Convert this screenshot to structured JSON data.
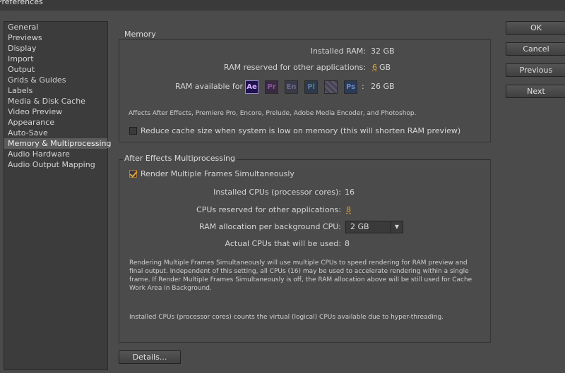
{
  "window": {
    "title": "Preferences"
  },
  "sidebar": {
    "items": [
      {
        "label": "General"
      },
      {
        "label": "Previews"
      },
      {
        "label": "Display"
      },
      {
        "label": "Import"
      },
      {
        "label": "Output"
      },
      {
        "label": "Grids & Guides"
      },
      {
        "label": "Labels"
      },
      {
        "label": "Media & Disk Cache"
      },
      {
        "label": "Video Preview"
      },
      {
        "label": "Appearance"
      },
      {
        "label": "Auto-Save"
      },
      {
        "label": "Memory & Multiprocessing",
        "selected": true
      },
      {
        "label": "Audio Hardware"
      },
      {
        "label": "Audio Output Mapping"
      }
    ]
  },
  "memory": {
    "title": "Memory",
    "installed_ram_label": "Installed RAM:",
    "installed_ram_value": "32 GB",
    "reserved_label": "RAM reserved for other applications:",
    "reserved_value": "6",
    "reserved_unit": "GB",
    "available_label": "RAM available for",
    "available_sep": ":",
    "available_value": "26 GB",
    "apps": [
      {
        "abbr": "Ae",
        "icon": "after-effects-icon",
        "color": "#d8b3ff",
        "bg": "#1e1250",
        "active": true
      },
      {
        "abbr": "Pr",
        "icon": "premiere-pro-icon",
        "color": "#8a5a9a",
        "bg": "#3a2a44",
        "active": false
      },
      {
        "abbr": "En",
        "icon": "encore-icon",
        "color": "#6a6a8a",
        "bg": "#3a3a48",
        "active": false
      },
      {
        "abbr": "Pl",
        "icon": "prelude-icon",
        "color": "#5a7aa0",
        "bg": "#2e3a4a",
        "active": false
      },
      {
        "abbr": "",
        "icon": "media-encoder-icon",
        "color": "#8a7aa0",
        "bg": "#4a4458",
        "active": false
      },
      {
        "abbr": "Ps",
        "icon": "photoshop-icon",
        "color": "#6a8ac0",
        "bg": "#2a3a58",
        "active": false
      }
    ],
    "affects_note": "Affects After Effects, Premiere Pro, Encore, Prelude, Adobe Media Encoder, and Photoshop.",
    "reduce_cache_label": "Reduce cache size when system is low on memory (this will shorten RAM preview)",
    "reduce_cache_checked": false
  },
  "mp": {
    "title": "After Effects Multiprocessing",
    "render_multi_label": "Render Multiple Frames Simultaneously",
    "render_multi_checked": true,
    "installed_cpus_label": "Installed CPUs (processor cores):",
    "installed_cpus_value": "16",
    "reserved_cpus_label": "CPUs reserved for other applications:",
    "reserved_cpus_value": "8",
    "ram_alloc_label": "RAM allocation per background CPU:",
    "ram_alloc_value": "2 GB",
    "actual_cpus_label": "Actual CPUs that will be used:",
    "actual_cpus_value": "8",
    "note1_l1": "Rendering Multiple Frames Simultaneously will use multiple CPUs to speed rendering for RAM preview and",
    "note1_l2": "final output. Independent of this setting, all CPUs (16) may be used to accelerate rendering within a single",
    "note1_l3": "frame. If Render Multiple Frames Simultaneously is off, the RAM allocation above will be still used for Cache",
    "note1_l4": "Work Area in Background.",
    "note2": "Installed CPUs (processor cores) counts the virtual (logical) CPUs available due to hyper-threading."
  },
  "buttons": {
    "ok": "OK",
    "cancel": "Cancel",
    "previous": "Previous",
    "next": "Next",
    "details": "Details..."
  }
}
